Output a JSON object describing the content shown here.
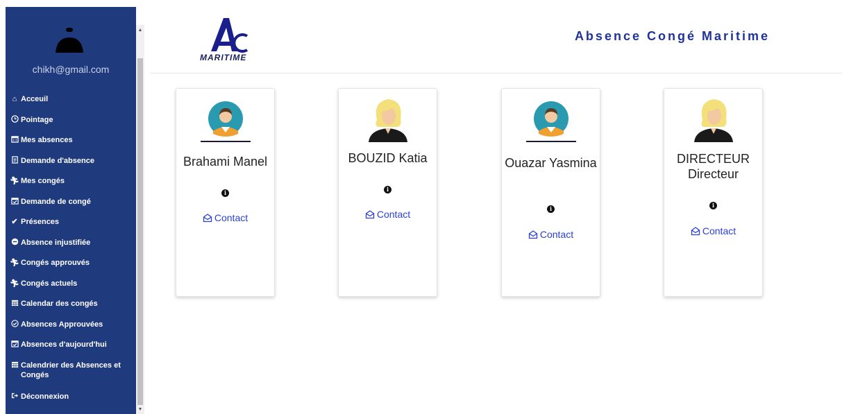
{
  "sidebar": {
    "email": "chikh@gmail.com",
    "items": [
      {
        "icon": "home-icon",
        "label": "Acceuil"
      },
      {
        "icon": "clock-icon",
        "label": "Pointage"
      },
      {
        "icon": "calendar-icon",
        "label": "Mes absences"
      },
      {
        "icon": "file-icon",
        "label": "Demande d'absence"
      },
      {
        "icon": "walking-icon",
        "label": "Mes congés"
      },
      {
        "icon": "calendar-check-icon",
        "label": "Demande de congé"
      },
      {
        "icon": "check-icon",
        "label": "Présences"
      },
      {
        "icon": "minus-circle-icon",
        "label": "Absence injustifiée"
      },
      {
        "icon": "walking-icon",
        "label": "Congés approuvés"
      },
      {
        "icon": "walking-icon",
        "label": "Congés actuels"
      },
      {
        "icon": "calendar-grid-icon",
        "label": "Calendar des congés"
      },
      {
        "icon": "check-circle-icon",
        "label": "Absences Approuvées"
      },
      {
        "icon": "calendar-check-icon",
        "label": "Absences d'aujourd'hui"
      },
      {
        "icon": "calendar-grid-icon",
        "label": "Calendrier des Absences et Congés"
      },
      {
        "icon": "sign-out-icon",
        "label": "Déconnexion"
      }
    ]
  },
  "header": {
    "logo_text": "MARITIME",
    "title": "Absence Congé Maritime"
  },
  "cards": [
    {
      "name": "Brahami Manel",
      "avatar": "male-avatar-icon",
      "contact_label": "Contact"
    },
    {
      "name": "BOUZID Katia",
      "avatar": "female-avatar-icon",
      "contact_label": "Contact"
    },
    {
      "name": "Ouazar Yasmina",
      "avatar": "male-avatar-icon",
      "contact_label": "Contact"
    },
    {
      "name": "DIRECTEUR Directeur",
      "avatar": "female-avatar-icon",
      "contact_label": "Contact"
    }
  ],
  "colors": {
    "sidebar_bg": "#1f3a7d",
    "title": "#1f3399",
    "link": "#2a3fd6"
  }
}
